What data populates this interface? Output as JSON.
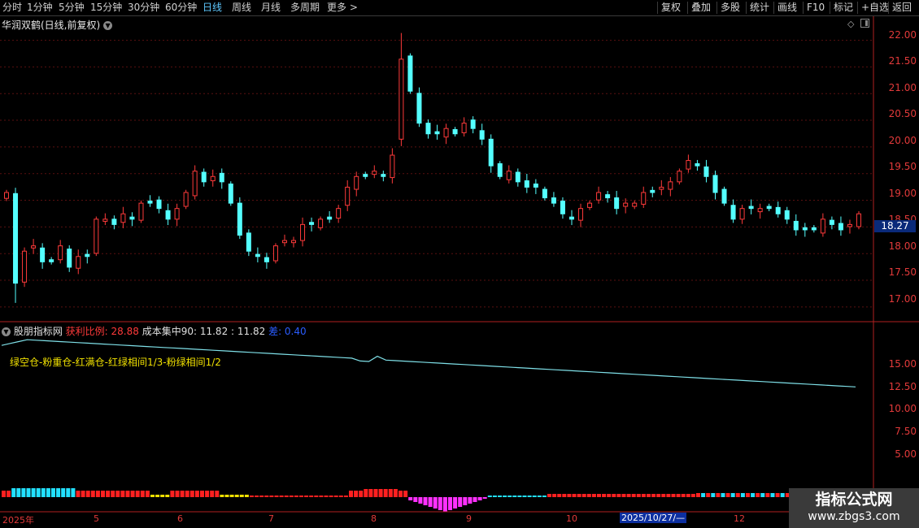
{
  "toolbar": {
    "periods": [
      {
        "label": "分时",
        "active": false
      },
      {
        "label": "1分钟",
        "active": false
      },
      {
        "label": "5分钟",
        "active": false
      },
      {
        "label": "15分钟",
        "active": false
      },
      {
        "label": "30分钟",
        "active": false
      },
      {
        "label": "60分钟",
        "active": false
      },
      {
        "label": "日线",
        "active": true
      },
      {
        "label": "周线",
        "active": false
      },
      {
        "label": "月线",
        "active": false
      },
      {
        "label": "多周期",
        "active": false
      },
      {
        "label": "更多 >",
        "active": false
      }
    ],
    "buttons": [
      "复权",
      "叠加",
      "多股",
      "统计",
      "画线",
      "F10",
      "标记",
      "+自选",
      "返回"
    ]
  },
  "stock_title": "华润双鹤(日线,前复权)",
  "price_axis": [
    "22.00",
    "21.50",
    "21.00",
    "20.50",
    "20.00",
    "19.50",
    "19.00",
    "18.50",
    "18.00",
    "17.50",
    "17.00"
  ],
  "last_price": "18.27",
  "indicator": {
    "name": "股朋指标网",
    "profit_label": "获利比例: 28.88",
    "cost_label": "成本集中90: 11.82 : 11.82",
    "diff_label": "差: 0.40",
    "legend": "绿空仓-粉重仓-红满仓-红绿相间1/3-粉绿相间1/2",
    "axis": [
      "15.00",
      "12.50",
      "10.00",
      "7.50",
      "5.00"
    ]
  },
  "date_axis": {
    "labels": [
      "2025年",
      "5",
      "6",
      "7",
      "8",
      "9",
      "10",
      "12"
    ],
    "cursor_date": "2025/10/27/—"
  },
  "watermark": {
    "title": "指标公式网",
    "url": "www.zbgs3.com"
  },
  "colors": {
    "up": "#ff3a3a",
    "down": "#54ffff",
    "line": "#7fe0e8",
    "axis": "#e23a3a"
  },
  "chart_data": {
    "type": "candlestick",
    "y_unit": "price",
    "ylim": [
      16.8,
      22.1
    ],
    "approx_closes": [
      19.1,
      17.4,
      18.0,
      18.1,
      17.8,
      17.8,
      18.1,
      17.7,
      17.9,
      17.9,
      18.6,
      18.6,
      18.5,
      18.7,
      18.6,
      18.9,
      18.9,
      18.8,
      18.6,
      18.8,
      19.1,
      19.5,
      19.3,
      19.4,
      19.3,
      18.9,
      18.3,
      18.0,
      17.9,
      17.8,
      18.1,
      18.2,
      18.2,
      18.5,
      18.5,
      18.6,
      18.6,
      18.8,
      19.2,
      19.4,
      19.4,
      19.5,
      19.4,
      19.8,
      21.6,
      21.0,
      20.4,
      20.2,
      20.2,
      20.3,
      20.2,
      20.4,
      20.3,
      20.1,
      19.6,
      19.4,
      19.5,
      19.3,
      19.2,
      19.2,
      19.0,
      18.9,
      18.7,
      18.6,
      18.8,
      18.9,
      19.1,
      19.0,
      18.8,
      18.9,
      18.9,
      19.1,
      19.1,
      19.2,
      19.3,
      19.5,
      19.7,
      19.6,
      19.4,
      19.1,
      18.9,
      18.6,
      18.8,
      18.8,
      18.8,
      18.8,
      18.7,
      18.6,
      18.4,
      18.4,
      18.4,
      18.6,
      18.5,
      18.4,
      18.5,
      18.7
    ],
    "indicator_line": {
      "name": "成本集中90",
      "start": 16.2,
      "peak": 16.8,
      "end": 11.82
    }
  }
}
